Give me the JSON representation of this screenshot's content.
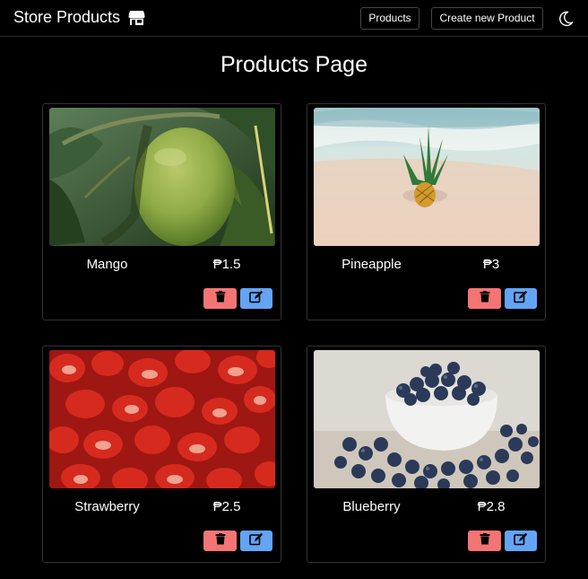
{
  "navbar": {
    "brand_title": "Store Products",
    "brand_icon": "store-icon",
    "products_label": "Products",
    "create_label": "Create new Product",
    "theme_icon": "moon-icon"
  },
  "page": {
    "title": "Products Page"
  },
  "colors": {
    "background": "#000000",
    "delete_button": "#f47474",
    "edit_button": "#63a4f5"
  },
  "products": [
    {
      "name": "Mango",
      "price": "₱1.5",
      "image": "green mango on tree"
    },
    {
      "name": "Pineapple",
      "price": "₱3",
      "image": "pineapple on beach"
    },
    {
      "name": "Strawberry",
      "price": "₱2.5",
      "image": "sliced strawberries"
    },
    {
      "name": "Blueberry",
      "price": "₱2.8",
      "image": "bowl of blueberries"
    }
  ]
}
